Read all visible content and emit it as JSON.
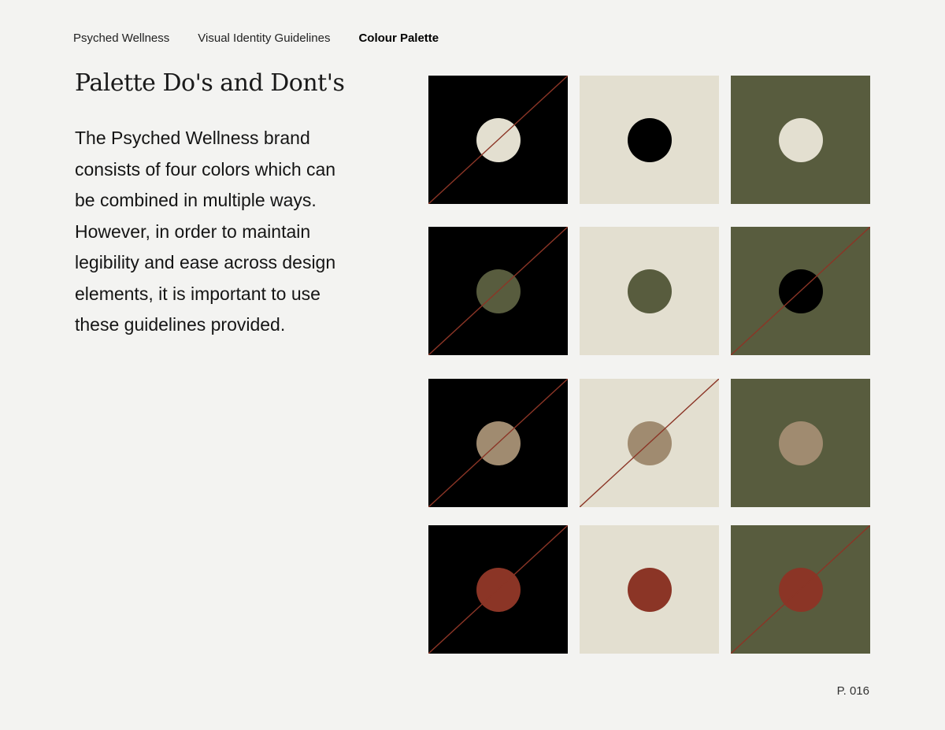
{
  "nav": {
    "brand": "Psyched Wellness",
    "section": "Visual Identity Guidelines",
    "current": "Colour Palette"
  },
  "heading": "Palette Do's and Dont's",
  "body": "The Psyched Wellness brand consists of four colors which can be combined in multiple ways. However, in order to maintain legibility and ease across design elements, it is important to use these guidelines provided.",
  "page_number": "P. 016",
  "colors": {
    "black": "#000000",
    "cream": "#e3dfd0",
    "olive": "#585c3e",
    "tan": "#a08b70",
    "red": "#8b3526",
    "strike": "#8b3526"
  },
  "swatches": [
    {
      "background": "black",
      "dot": "cream",
      "crossed": true
    },
    {
      "background": "cream",
      "dot": "black",
      "crossed": false
    },
    {
      "background": "olive",
      "dot": "cream",
      "crossed": false
    },
    {
      "background": "black",
      "dot": "olive",
      "crossed": true
    },
    {
      "background": "cream",
      "dot": "olive",
      "crossed": false
    },
    {
      "background": "olive",
      "dot": "black",
      "crossed": true
    },
    {
      "background": "black",
      "dot": "tan",
      "crossed": true
    },
    {
      "background": "cream",
      "dot": "tan",
      "crossed": true
    },
    {
      "background": "olive",
      "dot": "tan",
      "crossed": false
    },
    {
      "background": "black",
      "dot": "red",
      "crossed": true
    },
    {
      "background": "cream",
      "dot": "red",
      "crossed": false
    },
    {
      "background": "olive",
      "dot": "red",
      "crossed": true
    }
  ]
}
